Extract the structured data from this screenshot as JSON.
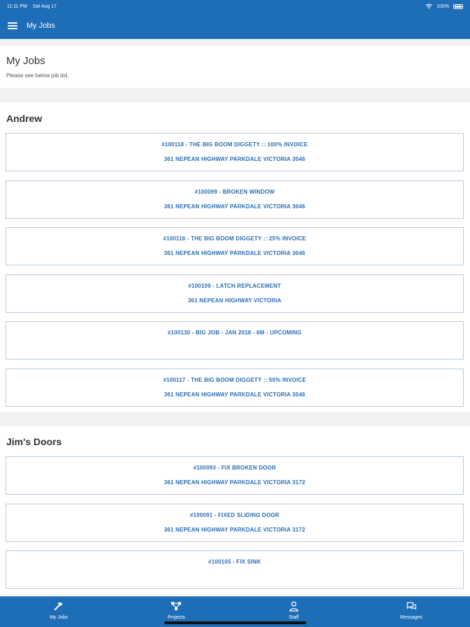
{
  "status_bar": {
    "time": "11:11 PM",
    "date": "Sat Aug 17",
    "battery": "100%"
  },
  "nav": {
    "title": "My Jobs"
  },
  "header": {
    "title": "My Jobs",
    "subtitle": "Please see below job list."
  },
  "sections": [
    {
      "title": "Andrew",
      "jobs": [
        {
          "title": "#100118 - THE BIG BOOM DIGGETY :: 100% INVOICE",
          "address": "361 NEPEAN HIGHWAY PARKDALE VICTORIA 3046"
        },
        {
          "title": "#100099 - BROKEN WINDOW",
          "address": "361 NEPEAN HIGHWAY PARKDALE VICTORIA 3046"
        },
        {
          "title": "#100116 - THE BIG BOOM DIGGETY :: 25% INVOICE",
          "address": "361 NEPEAN HIGHWAY PARKDALE VICTORIA 3046"
        },
        {
          "title": "#100109 - LATCH REPLACEMENT",
          "address": "361 NEPEAN HIGHWAY  VICTORIA"
        },
        {
          "title": "#100130 - BIG JOB - JAN 2018 - 6M - UPCOMING",
          "address": ""
        },
        {
          "title": "#100117 - THE BIG BOOM DIGGETY :: 50% INVOICE",
          "address": "361 NEPEAN HIGHWAY PARKDALE VICTORIA 3046"
        }
      ]
    },
    {
      "title": "Jim's Doors",
      "jobs": [
        {
          "title": "#100093 - FIX BROKEN DOOR",
          "address": "361 NEPEAN HIGHWAY PARKDALE VICTORIA 3172"
        },
        {
          "title": "#100091 - FIXED SLIDING DOOR",
          "address": "361 NEPEAN HIGHWAY PARKDALE VICTORIA 3172"
        },
        {
          "title": "#100105 - FIX SINK",
          "address": ""
        }
      ]
    }
  ],
  "tabs": [
    {
      "label": "My Jobs",
      "icon": "hammer-icon"
    },
    {
      "label": "Projects",
      "icon": "network-icon"
    },
    {
      "label": "Staff",
      "icon": "user-icon"
    },
    {
      "label": "Messages",
      "icon": "chat-bubbles-icon"
    }
  ],
  "colors": {
    "primary": "#1e6db7",
    "job_text": "#2a6db3",
    "card_border": "#b9cbdd",
    "background": "#f2f2f2"
  }
}
